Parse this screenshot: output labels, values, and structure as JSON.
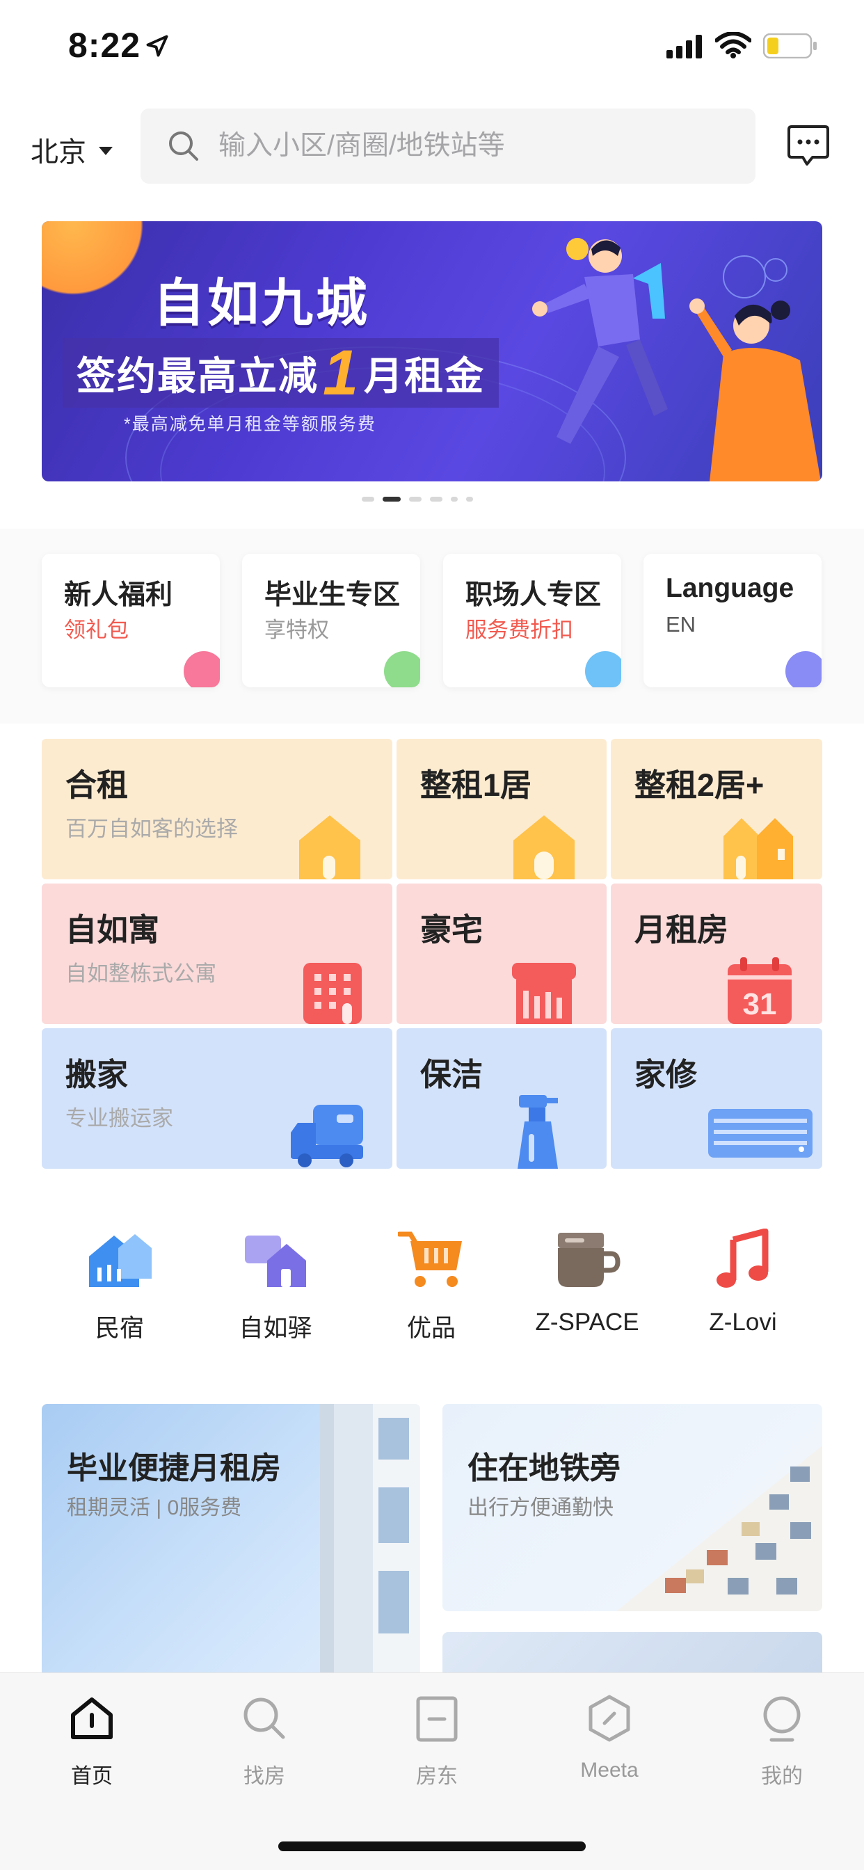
{
  "status": {
    "time": "8:22"
  },
  "header": {
    "city": "北京",
    "search_placeholder": "输入小区/商圈/地铁站等"
  },
  "banner": {
    "title": "自如九城",
    "subtitle_prefix": "签约最高立减",
    "subtitle_number": "1",
    "subtitle_suffix": "月租金",
    "note": "*最高减免单月租金等额服务费",
    "dots": 6,
    "active_dot": 1
  },
  "quick_cards": [
    {
      "title": "新人福利",
      "subtitle": "领礼包",
      "subtitle_color": "#f25a4f",
      "blob": "#f7789a"
    },
    {
      "title": "毕业生专区",
      "subtitle": "享特权",
      "subtitle_color": "#999999",
      "blob": "#8fdc8c"
    },
    {
      "title": "职场人专区",
      "subtitle": "服务费折扣",
      "subtitle_color": "#f25a4f",
      "blob": "#6fc2f7"
    },
    {
      "title": "Language",
      "subtitle": "EN",
      "subtitle_color": "#555555",
      "blob": "#8a8cf5"
    }
  ],
  "services": {
    "row1": [
      {
        "title": "合租",
        "subtitle": "百万自如客的选择",
        "icon": "house-icon"
      },
      {
        "title": "整租1居",
        "icon": "house-icon"
      },
      {
        "title": "整租2居+",
        "icon": "double-house-icon"
      }
    ],
    "row2": [
      {
        "title": "自如寓",
        "subtitle": "自如整栋式公寓",
        "icon": "building-icon"
      },
      {
        "title": "豪宅",
        "icon": "mansion-icon"
      },
      {
        "title": "月租房",
        "icon": "calendar-icon",
        "calendar_day": "31"
      }
    ],
    "row3": [
      {
        "title": "搬家",
        "subtitle": "专业搬运家",
        "icon": "truck-icon"
      },
      {
        "title": "保洁",
        "icon": "spray-bottle-icon"
      },
      {
        "title": "家修",
        "icon": "air-conditioner-icon"
      }
    ]
  },
  "mini_apps": [
    {
      "label": "民宿",
      "icon": "homestay-icon",
      "color": "#3f8ff0"
    },
    {
      "label": "自如驿",
      "icon": "station-icon",
      "color": "#7b6fe6"
    },
    {
      "label": "优品",
      "icon": "cart-icon",
      "color": "#f58a1f"
    },
    {
      "label": "Z-SPACE",
      "icon": "coffee-cup-icon",
      "color": "#7a6a5e"
    },
    {
      "label": "Z-Lovi",
      "icon": "music-note-icon",
      "color": "#ef4b46"
    }
  ],
  "promos": [
    {
      "title": "毕业便捷月租房",
      "subtitle": "租期灵活 | 0服务费"
    },
    {
      "title": "住在地铁旁",
      "subtitle": "出行方便通勤快"
    }
  ],
  "tabs": [
    {
      "label": "首页",
      "icon": "home-tab-icon",
      "active": true
    },
    {
      "label": "找房",
      "icon": "search-tab-icon"
    },
    {
      "label": "房东",
      "icon": "landlord-tab-icon"
    },
    {
      "label": "Meeta",
      "icon": "meeta-tab-icon"
    },
    {
      "label": "我的",
      "icon": "profile-tab-icon"
    }
  ]
}
